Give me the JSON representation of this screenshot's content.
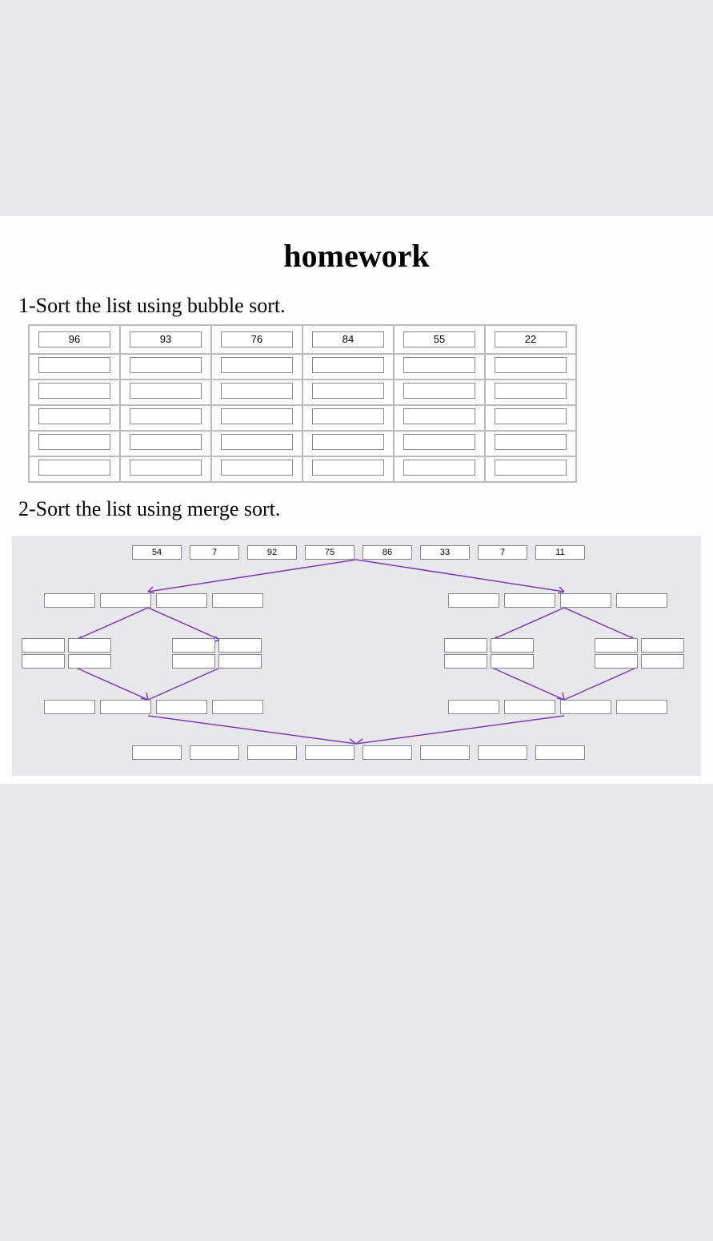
{
  "title": "homework",
  "q1": {
    "prompt": "1-Sort the list using bubble sort.",
    "values": [
      "96",
      "93",
      "76",
      "84",
      "55",
      "22"
    ],
    "blank_rows": 5,
    "cols": 6
  },
  "q2": {
    "prompt": "2-Sort the list using merge sort.",
    "values": [
      "54",
      "7",
      "92",
      "75",
      "86",
      "33",
      "7",
      "11"
    ]
  }
}
